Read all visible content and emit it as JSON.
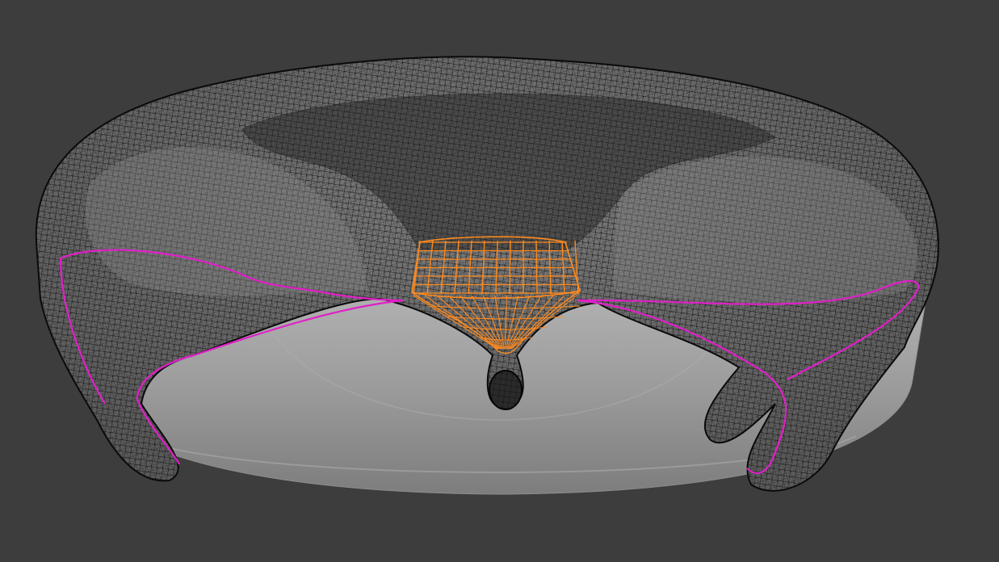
{
  "viewport": {
    "title": "",
    "background": "#3d3d3d",
    "mode": "edit-mode-wireframe"
  },
  "colors": {
    "plate": "#9a9a9a",
    "mesh_fill": "#6b6b6b",
    "wire": "#111111",
    "selected_wire": "#ff8a1e",
    "seam": "#e020c8"
  },
  "objects": [
    {
      "name": "cloth-mesh",
      "state": "wireframe"
    },
    {
      "name": "base-plate",
      "state": "solid"
    }
  ],
  "selection": {
    "face_region": "selected",
    "seam_edges": "marked"
  }
}
